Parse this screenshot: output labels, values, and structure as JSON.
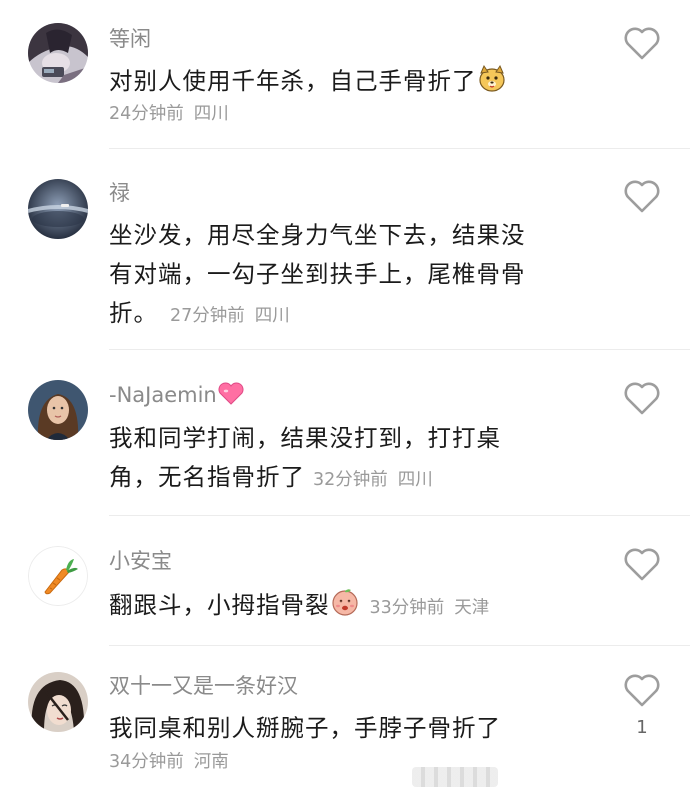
{
  "comments": [
    {
      "username": "等闲",
      "text": "对别人使用千年杀，自己手骨折了",
      "time": "24分钟前",
      "location": "四川",
      "likes": "",
      "emoji": "dog-face-emoji"
    },
    {
      "username": "禄",
      "text_lines": [
        "坐沙发，用尽全身力气坐下去，结果没",
        "有对端，一勾子坐到扶手上，尾椎骨骨",
        "折。"
      ],
      "time": "27分钟前",
      "location": "四川",
      "likes": ""
    },
    {
      "username": "-NaJaemin",
      "username_emoji": "pink-heart-emoji",
      "text_lines": [
        "我和同学打闹，结果没打到，打打桌",
        "角，无名指骨折了"
      ],
      "time": "32分钟前",
      "location": "四川",
      "likes": ""
    },
    {
      "username": "小安宝",
      "text": "翻跟斗，小拇指骨裂",
      "time": "33分钟前",
      "location": "天津",
      "likes": "",
      "emoji": "peach-face-emoji"
    },
    {
      "username": "双十一又是一条好汉",
      "text": "我同桌和别人掰腕子，手脖子骨折了",
      "time": "34分钟前",
      "location": "河南",
      "likes": "1"
    }
  ],
  "colors": {
    "username": "#8a8a8a",
    "text": "#1b1b1b",
    "meta": "#9a9a9a",
    "heart_outline": "#9d9d9d",
    "divider": "#ececec"
  },
  "icons": {
    "like": "heart-outline-icon",
    "carrot_avatar": "carrot-icon"
  }
}
